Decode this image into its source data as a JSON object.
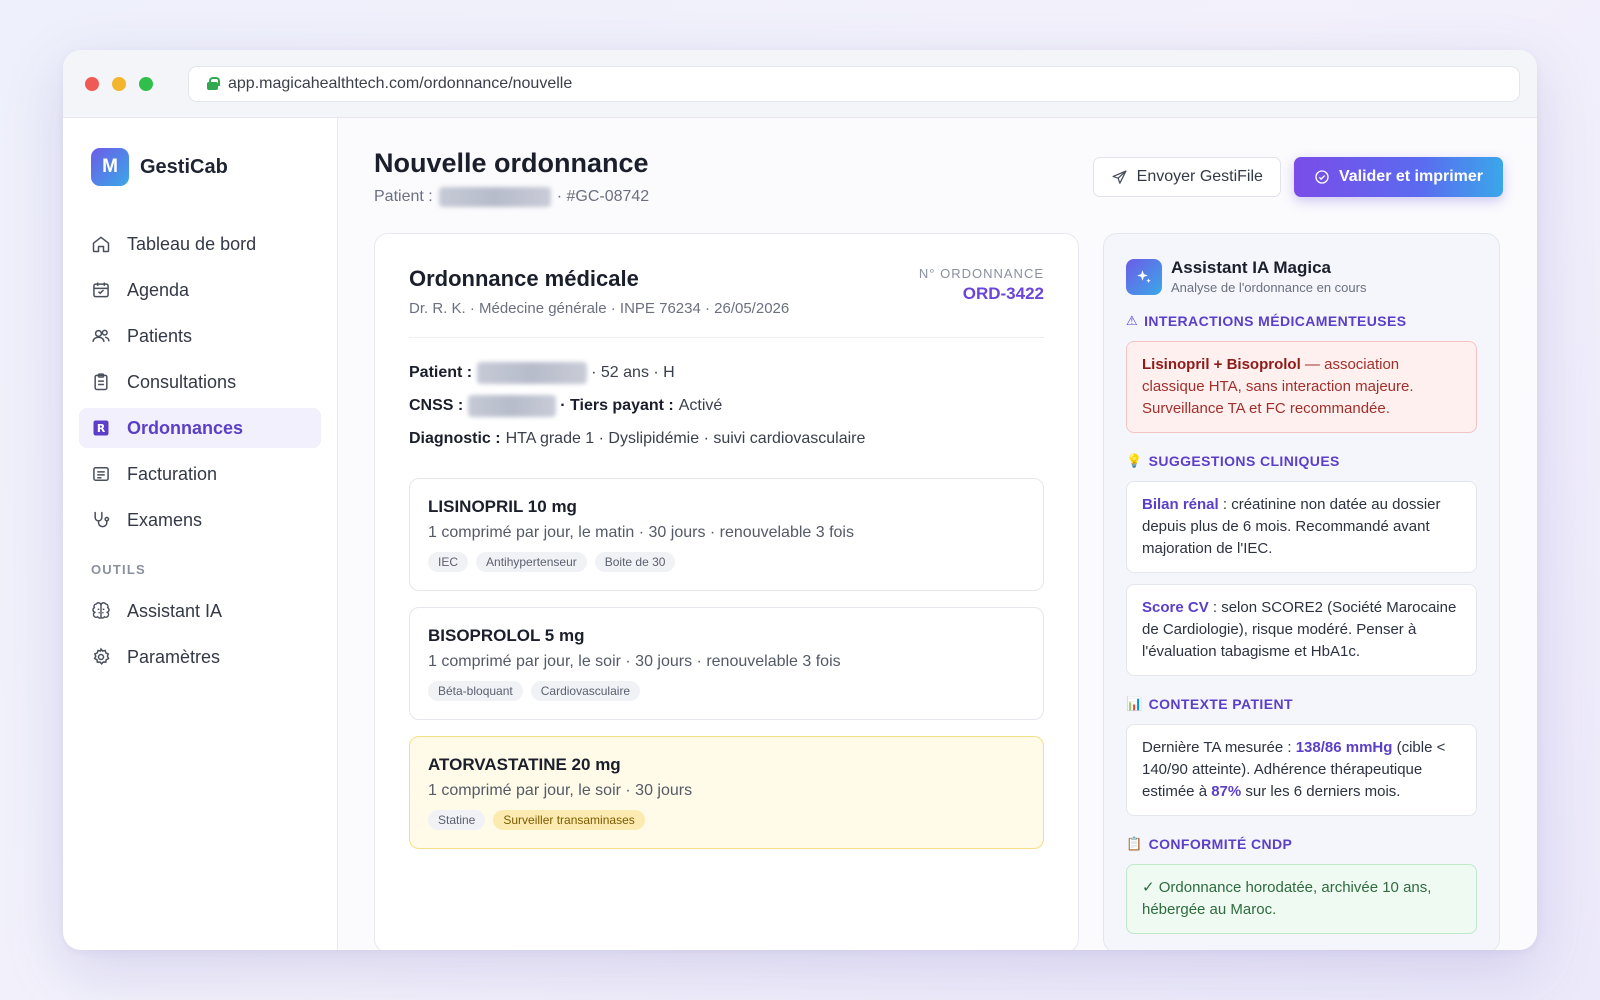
{
  "browser": {
    "url": "app.magicahealthtech.com/ordonnance/nouvelle"
  },
  "brand": {
    "logo_letter": "M",
    "name": "GestiCab"
  },
  "sidebar": {
    "items": [
      {
        "label": "Tableau de bord",
        "icon": "home-icon"
      },
      {
        "label": "Agenda",
        "icon": "calendar-icon"
      },
      {
        "label": "Patients",
        "icon": "users-icon"
      },
      {
        "label": "Consultations",
        "icon": "clipboard-icon"
      },
      {
        "label": "Ordonnances",
        "icon": "prescription-icon",
        "active": true
      },
      {
        "label": "Facturation",
        "icon": "invoice-icon"
      },
      {
        "label": "Examens",
        "icon": "stethoscope-icon"
      }
    ],
    "section_label": "OUTILS",
    "tools": [
      {
        "label": "Assistant IA",
        "icon": "brain-icon"
      },
      {
        "label": "Paramètres",
        "icon": "gear-icon"
      }
    ]
  },
  "header": {
    "title": "Nouvelle ordonnance",
    "patient_prefix": "Patient :",
    "patient_id": "· #GC-08742",
    "send_button": "Envoyer GestiFile",
    "validate_button": "Valider et imprimer"
  },
  "prescription": {
    "title": "Ordonnance médicale",
    "doctor_line": "Dr. R. K. · Médecine générale · INPE 76234 · 26/05/2026",
    "number_label": "N° ORDONNANCE",
    "number": "ORD-3422",
    "patient_label": "Patient :",
    "patient_details": "· 52 ans · H",
    "cnss_label": "CNSS :",
    "tiers_label": "· Tiers payant :",
    "tiers_value": "Activé",
    "diagnostic_label": "Diagnostic :",
    "diagnostic_value": "HTA grade 1 · Dyslipidémie · suivi cardiovasculaire",
    "medications": [
      {
        "name": "LISINOPRIL 10 mg",
        "dosage": "1 comprimé par jour, le matin · 30 jours · renouvelable 3 fois",
        "tags": [
          "IEC",
          "Antihypertenseur",
          "Boite de 30"
        ]
      },
      {
        "name": "BISOPROLOL 5 mg",
        "dosage": "1 comprimé par jour, le soir · 30 jours · renouvelable 3 fois",
        "tags": [
          "Béta-bloquant",
          "Cardiovasculaire"
        ]
      },
      {
        "name": "ATORVASTATINE 20 mg",
        "dosage": "1 comprimé par jour, le soir · 30 jours",
        "tags": [
          "Statine"
        ],
        "warning_tag": "Surveiller transaminases"
      }
    ]
  },
  "assistant": {
    "title": "Assistant IA Magica",
    "subtitle": "Analyse de l'ordonnance en cours",
    "interactions": {
      "heading": "INTERACTIONS MÉDICAMENTEUSES",
      "icon": "⚠",
      "highlight": "Lisinopril + Bisoprolol",
      "text": " — association classique HTA, sans interaction majeure. Surveillance TA et FC recommandée."
    },
    "suggestions": {
      "heading": "SUGGESTIONS CLINIQUES",
      "icon": "💡",
      "items": [
        {
          "highlight": "Bilan rénal",
          "text": " : créatinine non datée au dossier depuis plus de 6 mois. Recommandé avant majoration de l'IEC."
        },
        {
          "highlight": "Score CV",
          "text": " : selon SCORE2 (Société Marocaine de Cardiologie), risque modéré. Penser à l'évaluation tabagisme et HbA1c."
        }
      ]
    },
    "context": {
      "heading": "CONTEXTE PATIENT",
      "icon": "📊",
      "part1": "Dernière TA mesurée : ",
      "bp": "138/86 mmHg",
      "part2": " (cible < 140/90 atteinte). Adhérence thérapeutique estimée à ",
      "adherence": "87%",
      "part3": " sur les 6 derniers mois."
    },
    "compliance": {
      "heading": "CONFORMITÉ CNDP",
      "icon": "📋",
      "text": "✓ Ordonnance horodatée, archivée 10 ans, hébergée au Maroc."
    }
  },
  "colors": {
    "accent": "#5b3fc8",
    "accent_gradient_start": "#7a4de8",
    "accent_gradient_end": "#3aa7ea",
    "warning_bg": "#fffbe8",
    "danger_bg": "#fff0f0",
    "success_bg": "#effbf2"
  }
}
